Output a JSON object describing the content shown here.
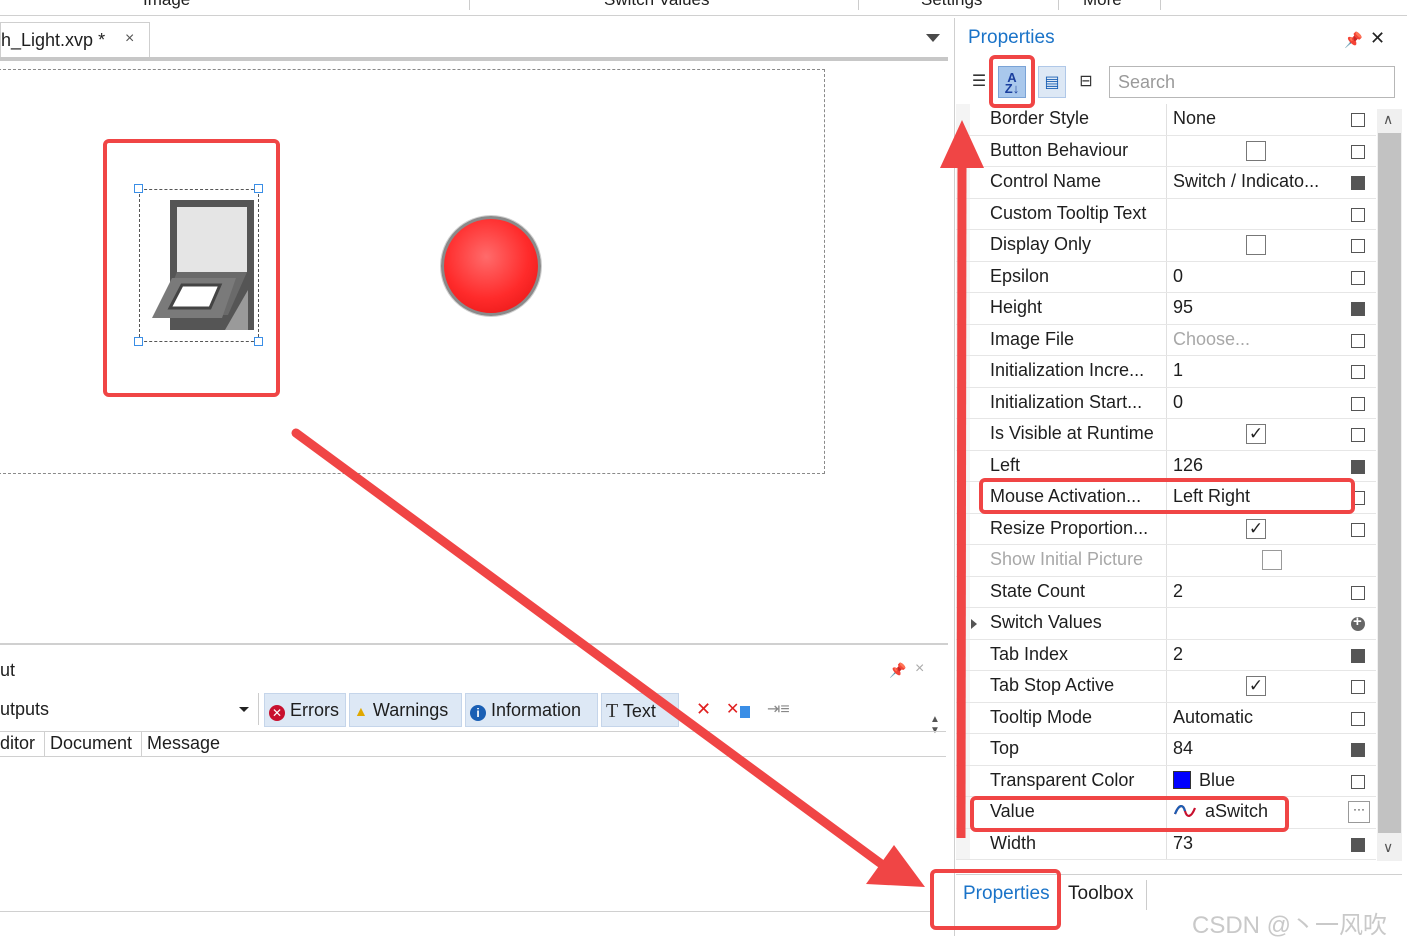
{
  "top_menu": [
    "Image",
    "Switch Values",
    "Settings",
    "More"
  ],
  "document_tab": {
    "title": "h_Light.xvp *",
    "close": "×"
  },
  "output": {
    "title": "ut",
    "combo": "utputs",
    "filters": [
      {
        "icon": "error-icon",
        "label": "Errors"
      },
      {
        "icon": "warning-icon",
        "label": "Warnings"
      },
      {
        "icon": "info-icon",
        "label": "Information"
      },
      {
        "icon": "text-icon",
        "label": "Text"
      }
    ],
    "columns": [
      "ditor",
      "Document",
      "Message"
    ]
  },
  "properties": {
    "title": "Properties",
    "search_placeholder": "Search",
    "rows": [
      {
        "name": "Border Style",
        "value": "None",
        "mark": "empty"
      },
      {
        "name": "Button Behaviour",
        "checkbox": false,
        "mark": "empty"
      },
      {
        "name": "Control Name",
        "value": "Switch  /  Indicato...",
        "mark": "filled"
      },
      {
        "name": "Custom Tooltip Text",
        "value": "",
        "mark": "empty"
      },
      {
        "name": "Display Only",
        "checkbox": false,
        "mark": "empty"
      },
      {
        "name": "Epsilon",
        "value": "0",
        "mark": "empty"
      },
      {
        "name": "Height",
        "value": "95",
        "mark": "filled"
      },
      {
        "name": "Image File",
        "value": "Choose...",
        "value_disabled": true,
        "mark": "empty"
      },
      {
        "name": "Initialization Incre...",
        "value": "1",
        "mark": "empty"
      },
      {
        "name": "Initialization Start...",
        "value": "0",
        "mark": "empty"
      },
      {
        "name": "Is Visible at Runtime",
        "checkbox": true,
        "mark": "empty"
      },
      {
        "name": "Left",
        "value": "126",
        "mark": "filled"
      },
      {
        "name": "Mouse Activation...",
        "value": "Left Right",
        "mark": "empty"
      },
      {
        "name": "Resize Proportion...",
        "checkbox": true,
        "mark": "empty"
      },
      {
        "name": "Show Initial Picture",
        "checkbox": false,
        "name_disabled": true,
        "mark": "none"
      },
      {
        "name": "State Count",
        "value": "2",
        "mark": "empty"
      },
      {
        "name": "Switch Values",
        "value": "",
        "expandable": true,
        "mark": "plus"
      },
      {
        "name": "Tab Index",
        "value": "2",
        "mark": "filled"
      },
      {
        "name": "Tab Stop Active",
        "checkbox": true,
        "mark": "empty"
      },
      {
        "name": "Tooltip Mode",
        "value": "Automatic",
        "mark": "empty"
      },
      {
        "name": "Top",
        "value": "84",
        "mark": "filled"
      },
      {
        "name": "Transparent Color",
        "value": "Blue",
        "swatch": "#0000ff",
        "mark": "empty"
      },
      {
        "name": "Value",
        "value": "aSwitch",
        "var_icon": true,
        "mark": "dots"
      },
      {
        "name": "Width",
        "value": "73",
        "mark": "filled"
      }
    ],
    "bottom_tabs": [
      "Properties",
      "Toolbox"
    ]
  },
  "watermark": "CSDN @丶一风吹",
  "colors": {
    "highlight": "#f04545",
    "accent": "#1a73c8",
    "led": "#ff2b2b"
  }
}
